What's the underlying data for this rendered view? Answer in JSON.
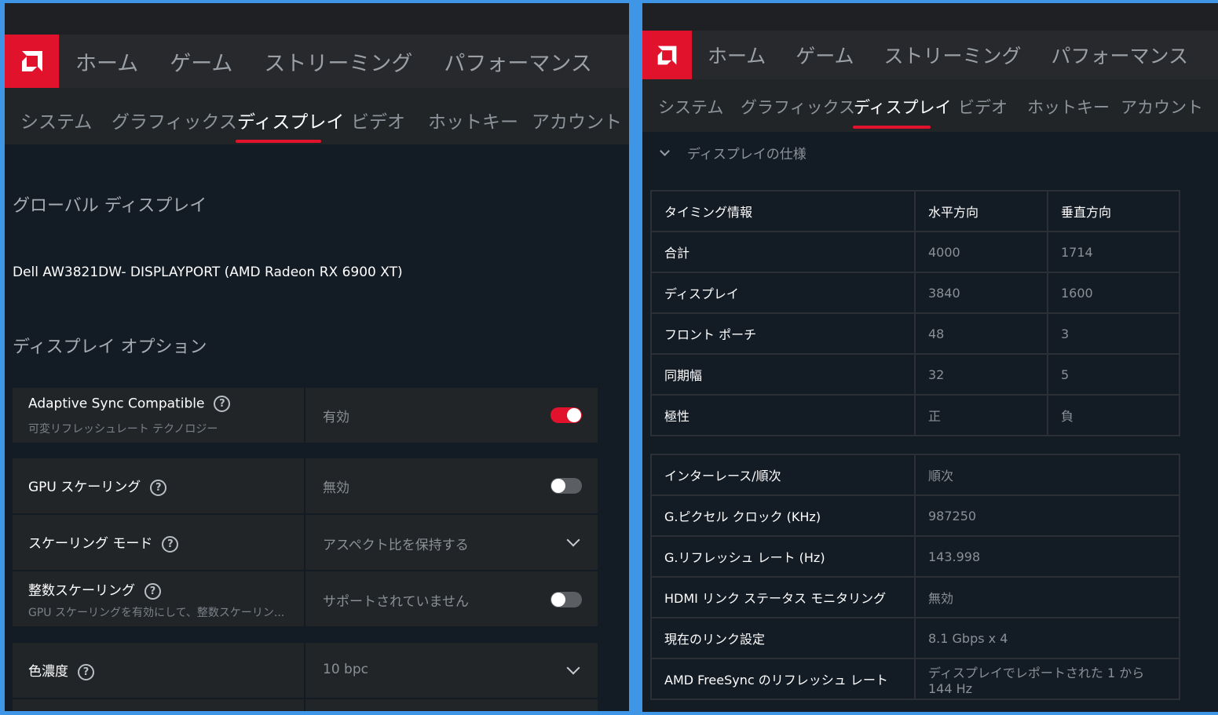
{
  "left": {
    "topnav": [
      "ホーム",
      "ゲーム",
      "ストリーミング",
      "パフォーマンス"
    ],
    "subnav": [
      "システム",
      "グラフィックス",
      "ディスプレイ",
      "ビデオ",
      "ホットキー",
      "アカウント"
    ],
    "global_display_title": "グローバル ディスプレイ",
    "monitor_name": "Dell AW3821DW- DISPLAYPORT (AMD Radeon RX 6900 XT)",
    "display_options_title": "ディスプレイ オプション",
    "options": {
      "adaptive_sync": {
        "label": "Adaptive Sync Compatible",
        "sub": "可変リフレッシュレート テクノロジー",
        "value": "有効",
        "enabled": true
      },
      "gpu_scaling": {
        "label": "GPU スケーリング",
        "value": "無効",
        "enabled": false
      },
      "scaling_mode": {
        "label": "スケーリング モード",
        "value": "アスペクト比を保持する"
      },
      "integer_scaling": {
        "label": "整数スケーリング",
        "sub": "GPU スケーリングを有効にして、整数スケーリン...",
        "value": "サポートされていません",
        "enabled": false
      },
      "color_depth": {
        "label": "色濃度",
        "value": "10 bpc"
      }
    },
    "help_glyph": "?"
  },
  "right": {
    "topnav": [
      "ホーム",
      "ゲーム",
      "ストリーミング",
      "パフォーマンス"
    ],
    "subnav": [
      "システム",
      "グラフィックス",
      "ディスプレイ",
      "ビデオ",
      "ホットキー",
      "アカウント"
    ],
    "spec_header": "ディスプレイの仕様",
    "timing_table": {
      "headers": [
        "タイミング情報",
        "水平方向",
        "垂直方向"
      ],
      "rows": [
        [
          "合計",
          "4000",
          "1714"
        ],
        [
          "ディスプレイ",
          "3840",
          "1600"
        ],
        [
          "フロント ポーチ",
          "48",
          "3"
        ],
        [
          "同期幅",
          "32",
          "5"
        ],
        [
          "極性",
          "正",
          "負"
        ]
      ]
    },
    "info_table": {
      "rows": [
        [
          "インターレース/順次",
          "順次"
        ],
        [
          "G.ピクセル クロック (KHz)",
          "987250"
        ],
        [
          "G.リフレッシュ レート (Hz)",
          "143.998"
        ],
        [
          "HDMI リンク ステータス モニタリング",
          "無効"
        ],
        [
          "現在のリンク設定",
          "8.1 Gbps x 4"
        ],
        [
          "AMD FreeSync のリフレッシュ レート",
          "ディスプレイでレポートされた 1 から 144 Hz"
        ]
      ]
    }
  },
  "colors": {
    "accent": "#e0122c",
    "background": "#131b25",
    "border": "#3f96e6"
  }
}
